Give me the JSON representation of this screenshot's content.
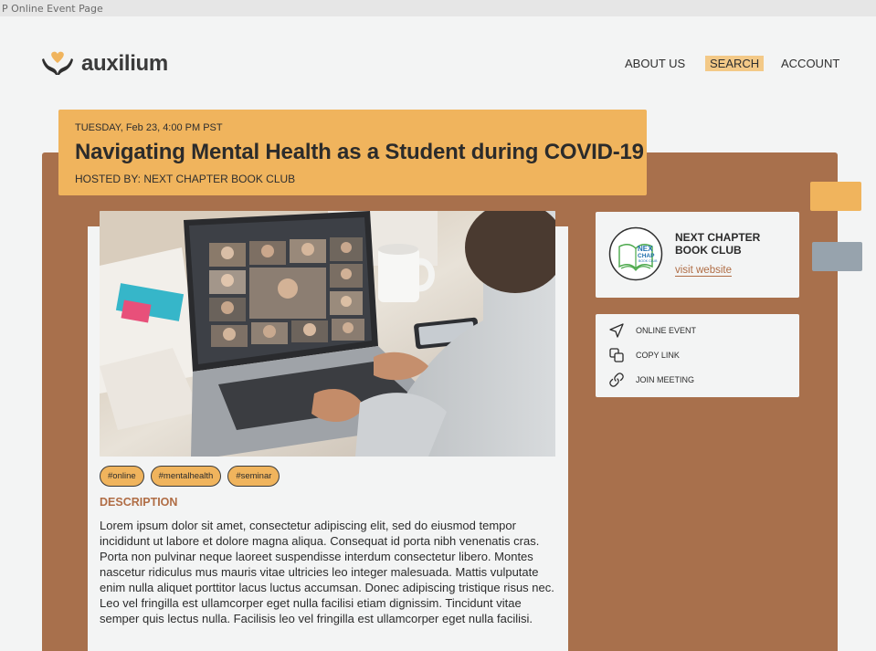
{
  "window": {
    "title": "P Online Event Page"
  },
  "brand": {
    "name": "auxilium",
    "icon": "heart-in-hands-icon",
    "accent": "#f0b45d",
    "panel_color": "#a8704c"
  },
  "nav": {
    "items": [
      {
        "label": "ABOUT US"
      },
      {
        "label": "SEARCH",
        "active": true
      },
      {
        "label": "ACCOUNT"
      }
    ]
  },
  "event": {
    "date": "TUESDAY, Feb 23, 4:00 PM PST",
    "title": "Navigating Mental Health as a Student during COVID-19",
    "host_line": "HOSTED BY: NEXT CHAPTER BOOK CLUB",
    "image_icon": "laptop-video-call-photo"
  },
  "tags": [
    "#online",
    "#mentalhealth",
    "#seminar"
  ],
  "description": {
    "heading": "DESCRIPTION",
    "body": "Lorem ipsum dolor sit amet, consectetur adipiscing elit, sed do eiusmod tempor incididunt ut labore et dolore magna aliqua. Consequat id porta nibh venenatis cras. Porta non pulvinar neque laoreet suspendisse interdum consectetur libero. Montes nascetur ridiculus mus mauris vitae ultricies leo integer malesuada. Mattis vulputate enim nulla aliquet porttitor lacus luctus accumsan. Donec adipiscing tristique risus nec. Leo vel fringilla est ullamcorper eget nulla facilisi etiam dignissim. Tincidunt vitae semper quis lectus nulla. Facilisis leo vel fringilla est ullamcorper eget nulla facilisi."
  },
  "host": {
    "name": "NEXT CHAPTER BOOK CLUB",
    "link": "visit website",
    "logo_text": "NEXT CHAPTER BOOK CLUB"
  },
  "actions": [
    {
      "label": "ONLINE EVENT",
      "icon": "navigation-arrow-icon"
    },
    {
      "label": "COPY LINK",
      "icon": "copy-icon"
    },
    {
      "label": "JOIN MEETING",
      "icon": "link-icon"
    }
  ]
}
